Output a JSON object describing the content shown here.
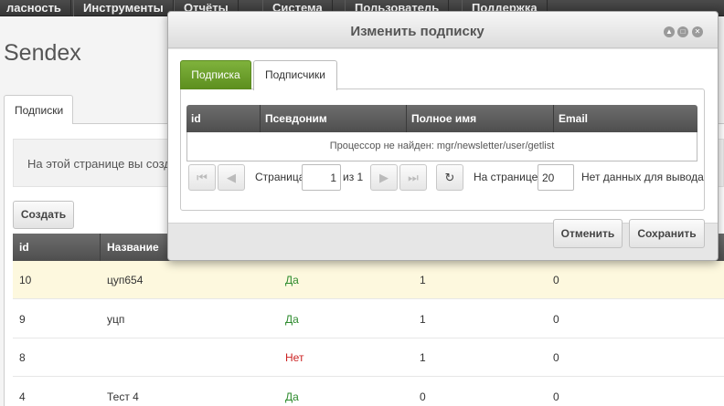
{
  "topmenu": {
    "items": [
      {
        "label": "ласность"
      },
      {
        "label": "Инструменты"
      },
      {
        "label": "Отчёты"
      },
      {
        "label": "Система"
      },
      {
        "label": "Пользователь"
      },
      {
        "label": "Поддержка"
      }
    ]
  },
  "app": {
    "title": "Sendex"
  },
  "page": {
    "tab_label": "Подписки",
    "description": "На этой странице вы созд",
    "create_label": "Создать",
    "grid": {
      "columns": [
        "id",
        "Название"
      ],
      "rows": [
        {
          "id": "10",
          "name": "цуп654",
          "active": "Да",
          "active_state": "yes",
          "count": "1",
          "extra": "0"
        },
        {
          "id": "9",
          "name": "уцп",
          "active": "Да",
          "active_state": "yes",
          "count": "1",
          "extra": "0"
        },
        {
          "id": "8",
          "name": "",
          "active": "Нет",
          "active_state": "no",
          "count": "1",
          "extra": "0"
        },
        {
          "id": "4",
          "name": "Тест 4",
          "active": "Да",
          "active_state": "yes",
          "count": "0",
          "extra": "0"
        }
      ]
    }
  },
  "modal": {
    "title": "Изменить подписку",
    "tabs": [
      {
        "label": "Подписка",
        "active": true
      },
      {
        "label": "Подписчики",
        "active": false
      }
    ],
    "grid": {
      "columns": [
        "id",
        "Псевдоним",
        "Полное имя",
        "Email"
      ],
      "empty_message": "Процессор не найден: mgr/newsletter/user/getlist"
    },
    "pager": {
      "page_label": "Страница",
      "page_value": "1",
      "of_label": "из 1",
      "per_page_label": "На странице:",
      "per_page_value": "20",
      "status": "Нет данных для вывода"
    },
    "cancel_label": "Отменить",
    "save_label": "Сохранить"
  },
  "colors": {
    "accent_green": "#6a9c2a",
    "header_dark": "#5a5a5a",
    "selected_row": "#fdf8de"
  }
}
